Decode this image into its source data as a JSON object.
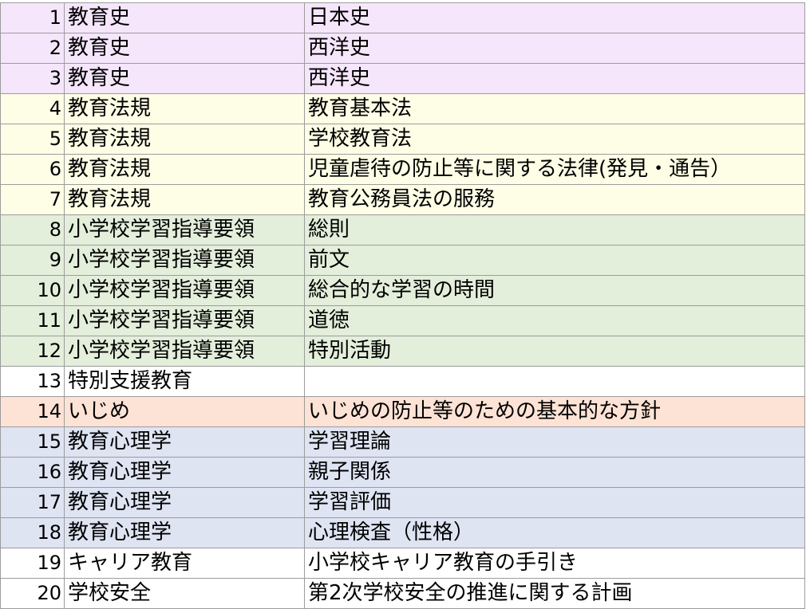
{
  "colors": {
    "pink": "#f5e6fb",
    "yellow": "#fefde6",
    "green": "#e3eedb",
    "white": "#ffffff",
    "peach": "#fde3d5",
    "blue": "#dfe4f3"
  },
  "rows": [
    {
      "num": "1",
      "category": "教育史",
      "topic": "日本史",
      "color": "#f5e6fb"
    },
    {
      "num": "2",
      "category": "教育史",
      "topic": "西洋史",
      "color": "#f5e6fb"
    },
    {
      "num": "3",
      "category": "教育史",
      "topic": "西洋史",
      "color": "#f5e6fb"
    },
    {
      "num": "4",
      "category": "教育法規",
      "topic": "教育基本法",
      "color": "#fefde6"
    },
    {
      "num": "5",
      "category": "教育法規",
      "topic": "学校教育法",
      "color": "#fefde6"
    },
    {
      "num": "6",
      "category": "教育法規",
      "topic": "児童虐待の防止等に関する法律(発見・通告）",
      "color": "#fefde6"
    },
    {
      "num": "7",
      "category": "教育法規",
      "topic": "教育公務員法の服務",
      "color": "#fefde6"
    },
    {
      "num": "8",
      "category": "小学校学習指導要領",
      "topic": "総則",
      "color": "#e3eedb"
    },
    {
      "num": "9",
      "category": "小学校学習指導要領",
      "topic": "前文",
      "color": "#e3eedb"
    },
    {
      "num": "10",
      "category": "小学校学習指導要領",
      "topic": "総合的な学習の時間",
      "color": "#e3eedb"
    },
    {
      "num": "11",
      "category": "小学校学習指導要領",
      "topic": "道徳",
      "color": "#e3eedb"
    },
    {
      "num": "12",
      "category": "小学校学習指導要領",
      "topic": "特別活動",
      "color": "#e3eedb"
    },
    {
      "num": "13",
      "category": "特別支援教育",
      "topic": "",
      "color": "#ffffff"
    },
    {
      "num": "14",
      "category": "いじめ",
      "topic": "いじめの防止等のための基本的な方針",
      "color": "#fde3d5"
    },
    {
      "num": "15",
      "category": "教育心理学",
      "topic": "学習理論",
      "color": "#dfe4f3"
    },
    {
      "num": "16",
      "category": "教育心理学",
      "topic": "親子関係",
      "color": "#dfe4f3"
    },
    {
      "num": "17",
      "category": "教育心理学",
      "topic": "学習評価",
      "color": "#dfe4f3"
    },
    {
      "num": "18",
      "category": "教育心理学",
      "topic": "心理検査（性格）",
      "color": "#dfe4f3"
    },
    {
      "num": "19",
      "category": "キャリア教育",
      "topic": "小学校キャリア教育の手引き",
      "color": "#ffffff"
    },
    {
      "num": "20",
      "category": "学校安全",
      "topic": "第2次学校安全の推進に関する計画",
      "color": "#ffffff"
    }
  ]
}
